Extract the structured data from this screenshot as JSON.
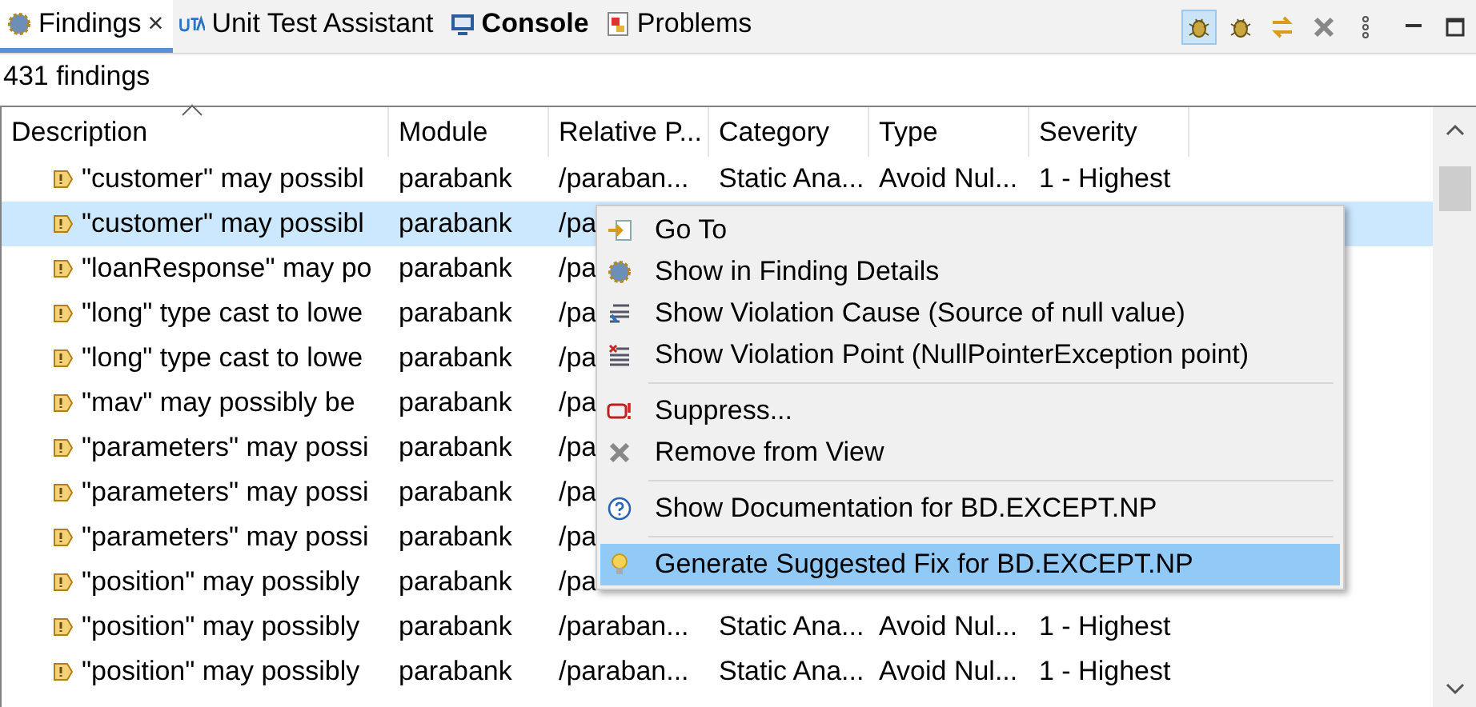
{
  "tabs": [
    {
      "label": "Findings",
      "selected": true,
      "bold": false,
      "close": "×"
    },
    {
      "label": "Unit Test Assistant",
      "selected": false,
      "bold": false
    },
    {
      "label": "Console",
      "selected": false,
      "bold": true
    },
    {
      "label": "Problems",
      "selected": false,
      "bold": false
    }
  ],
  "toolbar": [
    {
      "selected": true
    },
    {
      "selected": false
    },
    {
      "selected": false
    },
    {
      "selected": false
    },
    {
      "selected": false
    }
  ],
  "count": "431 findings",
  "table": {
    "columns": [
      "Description",
      "Module",
      "Relative P...",
      "Category",
      "Type",
      "Severity"
    ],
    "rows": [
      {
        "selected": false,
        "cells": [
          "\"customer\" may possibl",
          "parabank",
          "/paraban...",
          "Static Ana...",
          "Avoid Nul...",
          "1 - Highest"
        ]
      },
      {
        "selected": true,
        "cells": [
          "\"customer\" may possibl",
          "parabank",
          "/pa"
        ]
      },
      {
        "selected": false,
        "cells": [
          "\"loanResponse\" may po",
          "parabank",
          "/pa"
        ]
      },
      {
        "selected": false,
        "cells": [
          "\"long\" type cast to lowe",
          "parabank",
          "/pa"
        ]
      },
      {
        "selected": false,
        "cells": [
          "\"long\" type cast to lowe",
          "parabank",
          "/pa"
        ]
      },
      {
        "selected": false,
        "cells": [
          "\"mav\" may possibly be",
          "parabank",
          "/pa"
        ]
      },
      {
        "selected": false,
        "cells": [
          "\"parameters\" may possi",
          "parabank",
          "/pa"
        ]
      },
      {
        "selected": false,
        "cells": [
          "\"parameters\" may possi",
          "parabank",
          "/pa"
        ]
      },
      {
        "selected": false,
        "cells": [
          "\"parameters\" may possi",
          "parabank",
          "/pa"
        ]
      },
      {
        "selected": false,
        "cells": [
          "\"position\" may possibly",
          "parabank",
          "/pa"
        ]
      },
      {
        "selected": false,
        "cells": [
          "\"position\" may possibly",
          "parabank",
          "/paraban...",
          "Static Ana...",
          "Avoid Nul...",
          "1 - Highest"
        ]
      },
      {
        "selected": false,
        "cells": [
          "\"position\" may possibly",
          "parabank",
          "/paraban...",
          "Static Ana...",
          "Avoid Nul...",
          "1 - Highest"
        ]
      }
    ]
  },
  "context_menu": {
    "groups": [
      [
        {
          "label": "Go To",
          "selected": false
        },
        {
          "label": "Show in Finding Details",
          "selected": false
        },
        {
          "label": "Show Violation Cause (Source of null value)",
          "selected": false
        },
        {
          "label": "Show Violation Point (NullPointerException point)",
          "selected": false
        }
      ],
      [
        {
          "label": "Suppress...",
          "selected": false
        },
        {
          "label": "Remove from View",
          "selected": false
        }
      ],
      [
        {
          "label": "Show Documentation for BD.EXCEPT.NP",
          "selected": false
        }
      ],
      [
        {
          "label": "Generate Suggested Fix for BD.EXCEPT.NP",
          "selected": true
        }
      ]
    ]
  }
}
